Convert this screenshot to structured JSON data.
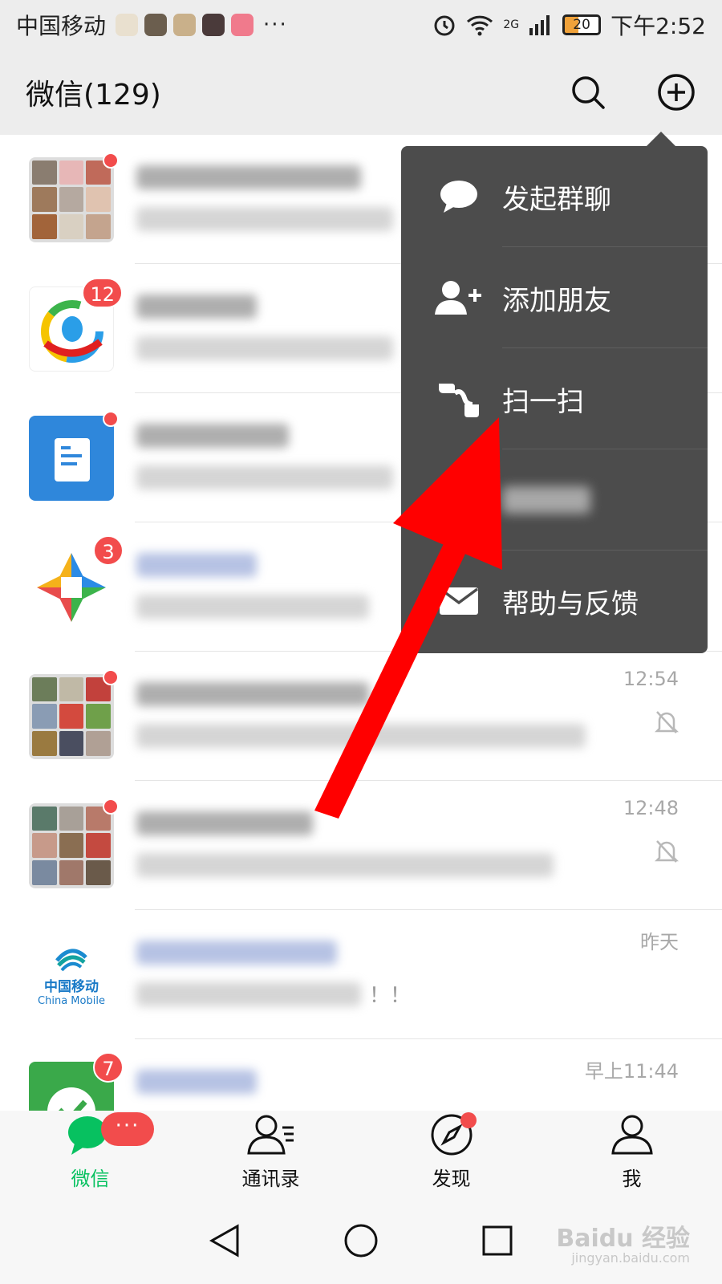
{
  "status_bar": {
    "carrier": "中国移动",
    "more": "···",
    "network": "2G",
    "battery": "20",
    "time": "下午2:52"
  },
  "header": {
    "title": "微信(129)"
  },
  "chats": [
    {
      "avatar": "group-collage",
      "badge": "",
      "dot": true,
      "time": "",
      "muted": false,
      "title_color": "gray"
    },
    {
      "avatar": "tencent-news",
      "badge": "12",
      "dot": false,
      "time": "",
      "muted": false,
      "title_color": "gray"
    },
    {
      "avatar": "subscription",
      "badge": "",
      "dot": true,
      "time": "",
      "muted": false,
      "title_color": "gray"
    },
    {
      "avatar": "wechat-games",
      "badge": "3",
      "dot": false,
      "time": "",
      "muted": false,
      "title_color": "blue"
    },
    {
      "avatar": "group-collage",
      "badge": "",
      "dot": true,
      "time": "12:54",
      "muted": true,
      "title_color": "gray"
    },
    {
      "avatar": "group-collage",
      "badge": "",
      "dot": true,
      "time": "12:48",
      "muted": true,
      "title_color": "gray"
    },
    {
      "avatar": "china-mobile",
      "badge": "",
      "dot": false,
      "time": "昨天",
      "muted": false,
      "title_color": "blue",
      "avatar_text_cn": "中国移动",
      "avatar_text_en": "China Mobile",
      "subtitle_visible": "！！"
    },
    {
      "avatar": "wechat-pay",
      "badge": "7",
      "dot": false,
      "time": "早上11:44",
      "muted": false,
      "title_color": "blue"
    }
  ],
  "menu": {
    "items": [
      {
        "label": "发起群聊",
        "icon": "chat-bubble-icon"
      },
      {
        "label": "添加朋友",
        "icon": "add-friend-icon"
      },
      {
        "label": "扫一扫",
        "icon": "scan-icon"
      },
      {
        "label": "",
        "icon": "blurred-item-icon"
      },
      {
        "label": "帮助与反馈",
        "icon": "mail-icon"
      }
    ]
  },
  "tabs": [
    {
      "label": "微信",
      "icon": "chats-icon",
      "active": true,
      "badge": "···"
    },
    {
      "label": "通讯录",
      "icon": "contacts-icon",
      "active": false
    },
    {
      "label": "发现",
      "icon": "discover-icon",
      "active": false,
      "dot": true
    },
    {
      "label": "我",
      "icon": "me-icon",
      "active": false
    }
  ],
  "watermark": {
    "main": "Baidu 经验",
    "sub": "jingyan.baidu.com"
  },
  "colors": {
    "accent_green": "#07c160",
    "badge_red": "#f24c4c",
    "menu_bg": "#4c4c4c",
    "arrow_red": "#ff0000"
  }
}
